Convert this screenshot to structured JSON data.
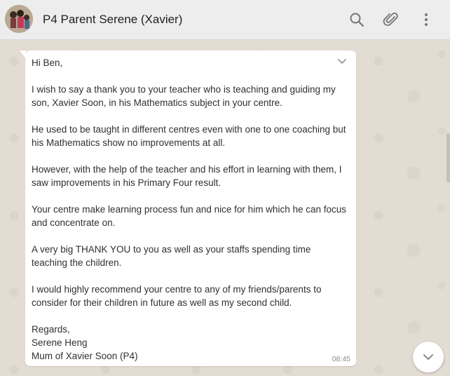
{
  "header": {
    "title": "P4 Parent Serene (Xavier)",
    "avatar_icon": "contact-photo",
    "search_icon": "search-icon",
    "attach_icon": "paperclip-icon",
    "menu_icon": "more-vertical-icon"
  },
  "message": {
    "greeting": "Hi Ben,",
    "paragraphs": [
      "I wish to say a thank you to your teacher who is teaching and guiding my son, Xavier Soon, in his Mathematics subject in your centre.",
      "He used to be taught in different centres even with one to one coaching but his Mathematics show no improvements at all.",
      "However, with the help of the teacher and his effort in learning with them, I saw improvements in his Primary Four result.",
      "Your centre make learning process fun and nice for him which he can focus and concentrate on.",
      "A very big THANK YOU to you as well as your staffs spending time teaching the children.",
      "I would highly recommend your centre to any of my friends/parents to consider for their children in future as well as my second child."
    ],
    "signoff": "Regards,",
    "sender_name": "Serene Heng",
    "sender_role": "Mum of Xavier Soon (P4)",
    "time": "08:45"
  },
  "colors": {
    "header_bg": "#ededed",
    "chat_bg": "#e3dcd2",
    "bubble_bg": "#ffffff",
    "icon_grey": "#757575"
  }
}
